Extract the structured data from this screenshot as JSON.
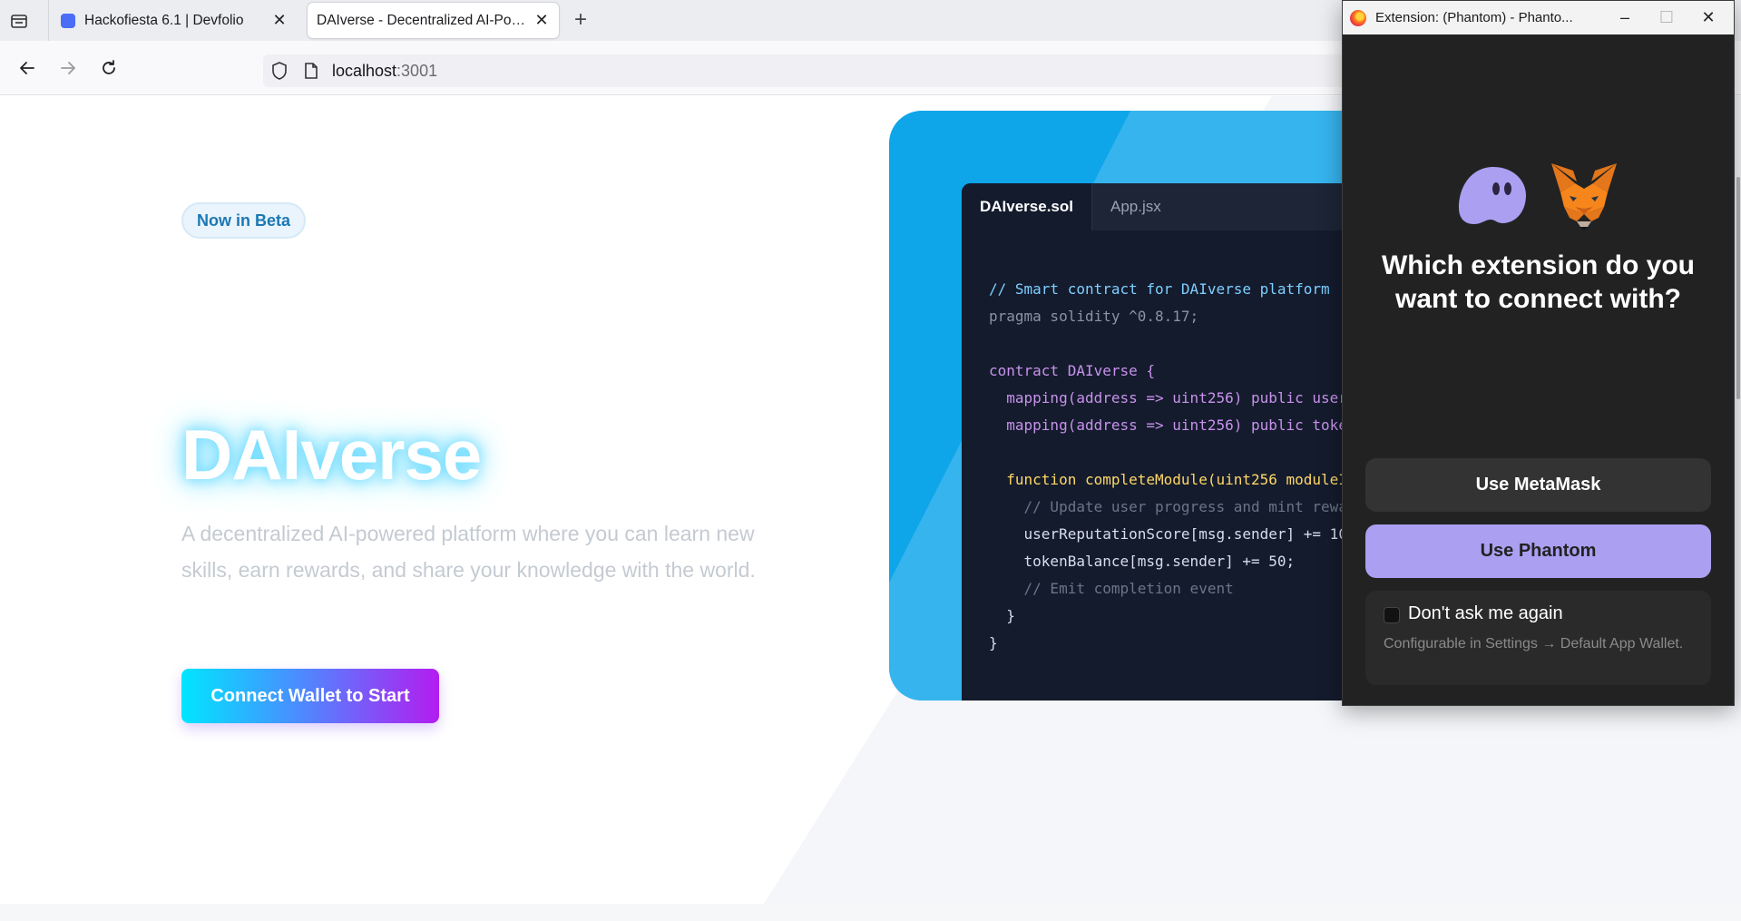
{
  "browser": {
    "tabs": [
      {
        "title": "Hackofiesta 6.1 | Devfolio",
        "active": false
      },
      {
        "title": "DAIverse - Decentralized AI-Powered",
        "active": true
      }
    ],
    "new_tab": "+",
    "url_host": "localhost",
    "url_port": ":3001"
  },
  "page": {
    "beta_badge": "Now in Beta",
    "title": "DAIverse",
    "subtitle": "A decentralized AI-powered platform where you can learn new skills, earn rewards, and share your knowledge with the world.",
    "cta_label": "Connect Wallet to Start",
    "editor": {
      "tabs": [
        "DAIverse.sol",
        "App.jsx"
      ],
      "code_lines": [
        "// Smart contract for DAIverse platform",
        "pragma solidity ^0.8.17;",
        "",
        "contract DAIverse {",
        "  mapping(address => uint256) public user",
        "  mapping(address => uint256) public toke",
        "",
        "  function completeModule(uint256 moduleI",
        "    // Update user progress and mint rewa",
        "    userReputationScore[msg.sender] += 10",
        "    tokenBalance[msg.sender] += 50;",
        "    // Emit completion event",
        "  }",
        "}"
      ]
    }
  },
  "popup": {
    "window_title": "Extension: (Phantom) - Phanto...",
    "question": "Which extension do you want to connect with?",
    "metamask_button": "Use MetaMask",
    "phantom_button": "Use Phantom",
    "dont_ask_label": "Don't ask me again",
    "dont_ask_hint": "Configurable in Settings → Default App Wallet.",
    "logos": [
      "phantom-ghost-icon",
      "metamask-fox-icon"
    ]
  },
  "colors": {
    "cta_gradient": [
      "#00e6ff",
      "#b41cf0"
    ],
    "phantom_purple": "#ab9ff2",
    "card_blue": "#0ea5e9"
  }
}
